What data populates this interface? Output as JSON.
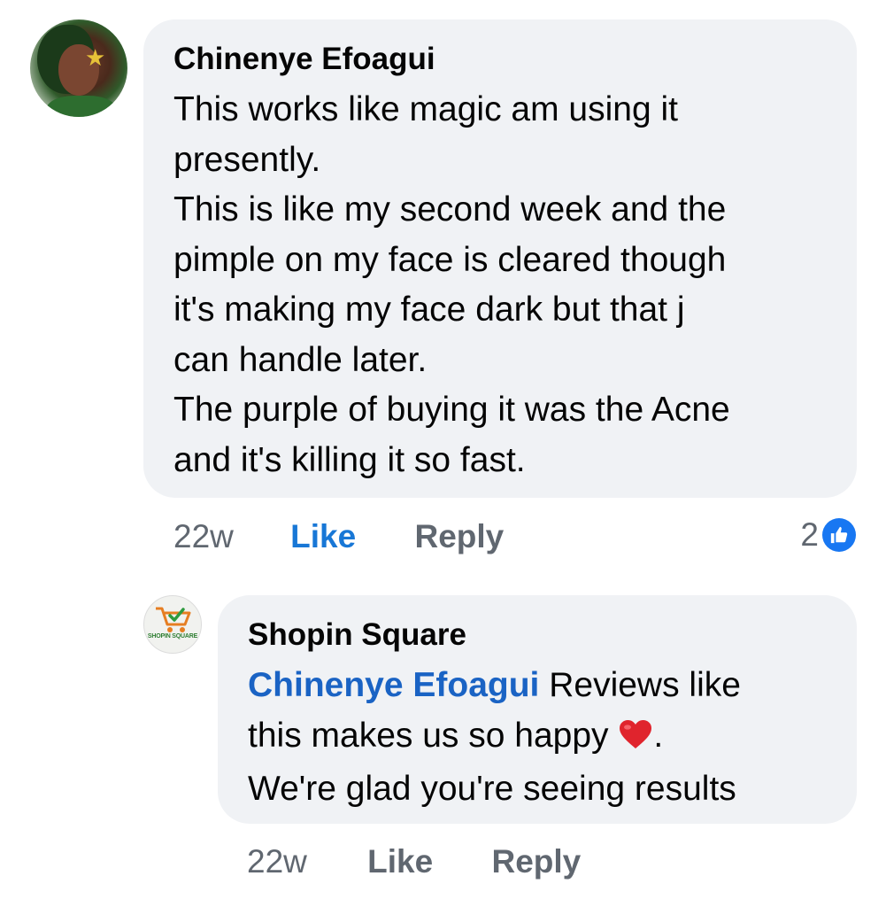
{
  "comment": {
    "author": "Chinenye Efoagui",
    "lines": [
      "This works like magic am using it",
      "presently.",
      "This is like my second week and the",
      "pimple on my face is cleared though",
      "it's making my face dark but that j",
      "can handle later.",
      "The purple of buying it was the Acne",
      "and it's killing it so fast."
    ],
    "timestamp": "22w",
    "like_label": "Like",
    "reply_label": "Reply",
    "reaction_count": "2",
    "reaction_icon": "thumbs-up-icon",
    "colors": {
      "bubble": "#f0f2f5",
      "like_active": "#1877d6",
      "reaction_badge": "#1877f2"
    }
  },
  "reply": {
    "author": "Shopin Square",
    "avatar_text": "SHOPIN SQUARE",
    "mention": "Chinenye Efoagui",
    "line1_rest": " Reviews like",
    "line2": "this makes us so happy ",
    "line2_after_heart": ".",
    "line3": "We're glad you're seeing results",
    "emoji": "heart-icon",
    "timestamp": "22w",
    "like_label": "Like",
    "reply_label": "Reply",
    "colors": {
      "mention": "#1a63c4",
      "heart": "#e0242d"
    }
  }
}
